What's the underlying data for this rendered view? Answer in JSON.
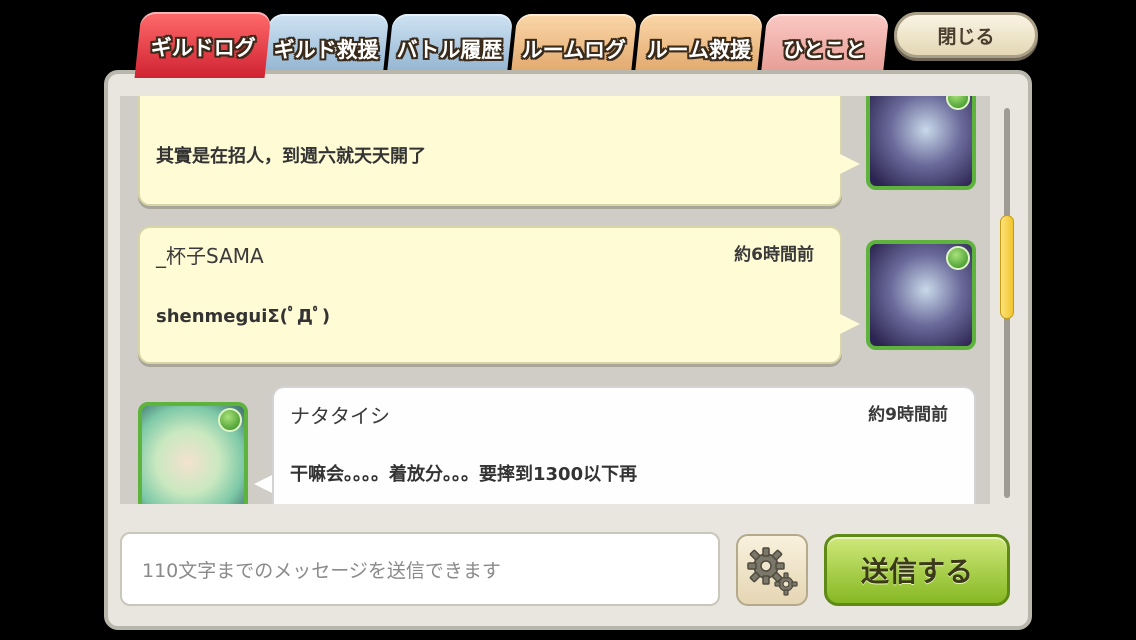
{
  "tabs": [
    {
      "label": "ギルドログ",
      "active": true
    },
    {
      "label": "ギルド救援",
      "active": false
    },
    {
      "label": "バトル履歴",
      "active": false
    },
    {
      "label": "ルームログ",
      "active": false
    },
    {
      "label": "ルーム救援",
      "active": false
    },
    {
      "label": "ひとこと",
      "active": false
    }
  ],
  "close_label": "閉じる",
  "messages": [
    {
      "name": "",
      "time": "",
      "text": "其實是在招人，到週六就天天開了"
    },
    {
      "name": "_杯子SAMA",
      "time": "約6時間前",
      "text": "shenmeguiΣ(ﾟДﾟ)"
    },
    {
      "name": "ナタタイシ",
      "time": "約9時間前",
      "text": "干嘛会。。。。着放分。。。要摔到1300以下再"
    }
  ],
  "input_placeholder": "110文字までのメッセージを送信できます",
  "send_label": "送信する",
  "colors": {
    "active_tab": "#d02232",
    "own_bubble": "#fefbd5",
    "other_bubble": "#fefefe",
    "avatar_border": "#5db33c",
    "send_button": "#86b823"
  },
  "icons": [
    "settings-gear-icon",
    "guild-badge-icon"
  ]
}
